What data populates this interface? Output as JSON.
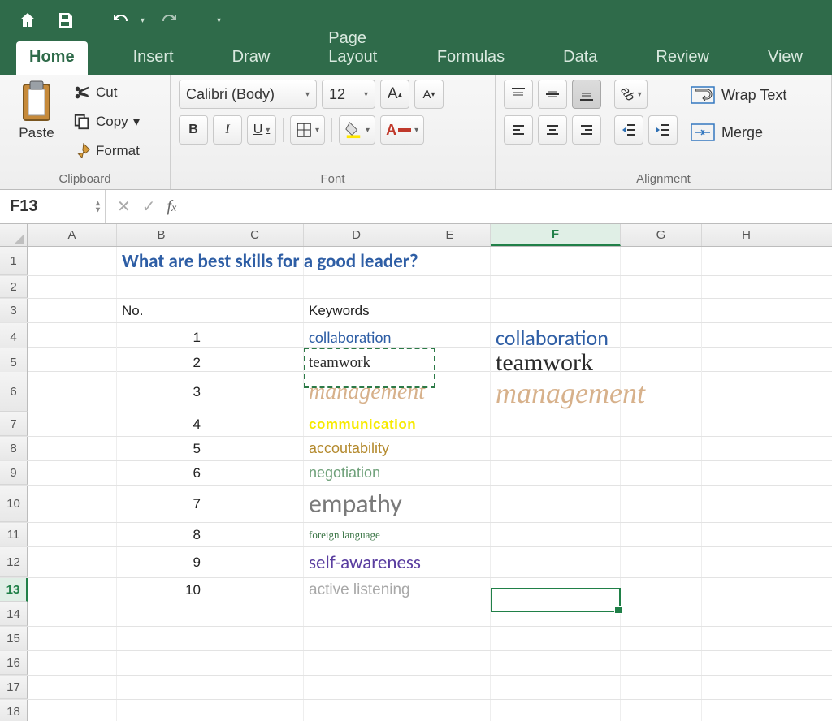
{
  "qa": {
    "home": "Home",
    "save": "Save",
    "undo": "Undo",
    "redo": "Redo"
  },
  "tabs": [
    "Home",
    "Insert",
    "Draw",
    "Page Layout",
    "Formulas",
    "Data",
    "Review",
    "View"
  ],
  "active_tab": 0,
  "ribbon": {
    "clipboard": {
      "label": "Clipboard",
      "paste": "Paste",
      "cut": "Cut",
      "copy": "Copy",
      "format": "Format"
    },
    "font": {
      "label": "Font",
      "family": "Calibri (Body)",
      "size": "12",
      "grow": "A",
      "shrink": "A",
      "bold": "B",
      "italic": "I",
      "underline": "U"
    },
    "alignment": {
      "label": "Alignment",
      "wrap": "Wrap Text",
      "merge": "Merge"
    }
  },
  "name_box": "F13",
  "columns": [
    "A",
    "B",
    "C",
    "D",
    "E",
    "F",
    "G",
    "H"
  ],
  "selected_col_idx": 5,
  "rows": [
    1,
    2,
    3,
    4,
    5,
    6,
    7,
    8,
    9,
    10,
    11,
    12,
    13,
    14,
    15,
    16,
    17,
    18
  ],
  "selected_row_idx": 12,
  "content": {
    "title": "What are best skills for a good leader?",
    "no_header": "No.",
    "kw_header": "Keywords",
    "items": [
      {
        "n": "1",
        "kw": "collaboration",
        "style": "kw-collab"
      },
      {
        "n": "2",
        "kw": "teamwork",
        "style": "kw-team"
      },
      {
        "n": "3",
        "kw": "management",
        "style": "kw-mgmt"
      },
      {
        "n": "4",
        "kw": "communication",
        "style": "kw-comm"
      },
      {
        "n": "5",
        "kw": "accoutability",
        "style": "kw-acc"
      },
      {
        "n": "6",
        "kw": "negotiation",
        "style": "kw-neg"
      },
      {
        "n": "7",
        "kw": "empathy",
        "style": "kw-emp"
      },
      {
        "n": "8",
        "kw": "foreign language",
        "style": "kw-lang"
      },
      {
        "n": "9",
        "kw": "self-awareness",
        "style": "kw-self"
      },
      {
        "n": "10",
        "kw": "active listening",
        "style": "kw-act"
      }
    ],
    "floats": {
      "collab": "collaboration",
      "team": "teamwork",
      "mgmt": "management"
    }
  }
}
